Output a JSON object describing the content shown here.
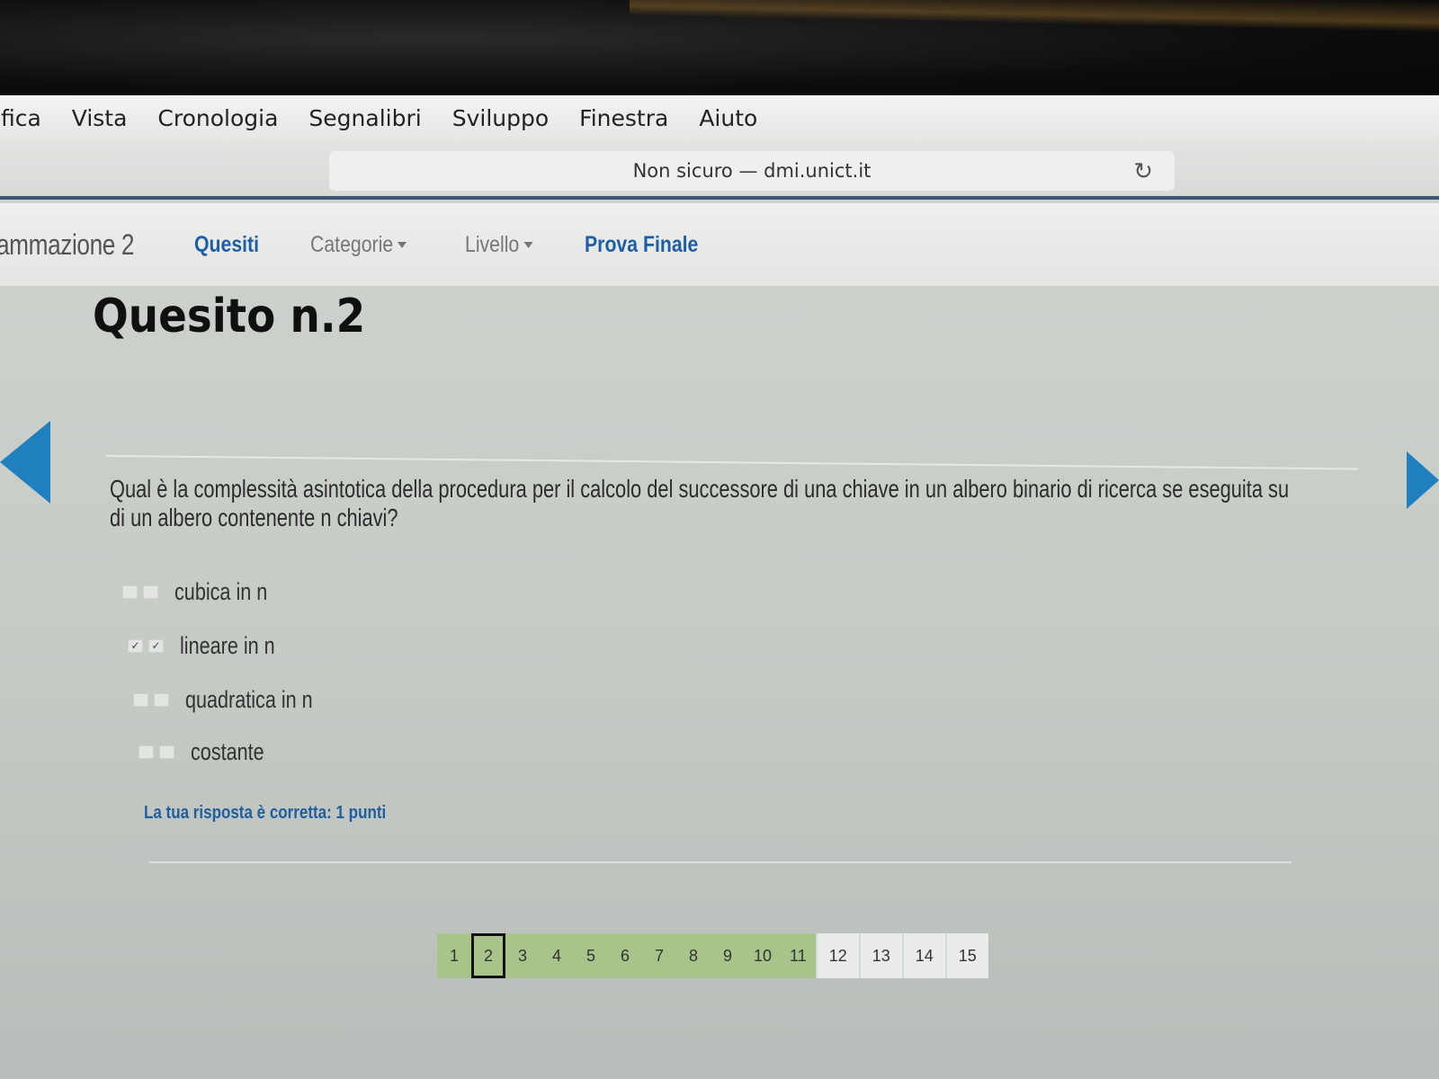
{
  "menubar": {
    "items": [
      "ifica",
      "Vista",
      "Cronologia",
      "Segnalibri",
      "Sviluppo",
      "Finestra",
      "Aiuto"
    ]
  },
  "menu_icons": [
    "dropbox-icon",
    "shield-icon",
    "script-icon",
    "bluetooth-icon"
  ],
  "address_bar": {
    "text": "Non sicuro — dmi.unict.it",
    "reload_icon": "reload-icon"
  },
  "navbar": {
    "brand": "ammazione 2",
    "items": [
      {
        "label": "Quesiti",
        "active": true,
        "dropdown": false
      },
      {
        "label": "Categorie",
        "active": false,
        "dropdown": true
      },
      {
        "label": "Livello",
        "active": false,
        "dropdown": true
      },
      {
        "label": "Prova Finale",
        "active": true,
        "dropdown": false
      }
    ]
  },
  "question": {
    "title": "Quesito n.2",
    "text": "Qual è la complessità asintotica della procedura per il calcolo del successore di una chiave in un albero binario di ricerca se eseguita su di un albero contenente n chiavi?",
    "options": [
      {
        "label": "cubica in n",
        "checked": false
      },
      {
        "label": "lineare in n",
        "checked": true
      },
      {
        "label": "quadratica in n",
        "checked": false
      },
      {
        "label": "costante",
        "checked": false
      }
    ],
    "feedback": "La tua risposta è corretta: 1 punti"
  },
  "pagination": {
    "pages": [
      "1",
      "2",
      "3",
      "4",
      "5",
      "6",
      "7",
      "8",
      "9",
      "10",
      "11",
      "12",
      "13",
      "14",
      "15"
    ],
    "current": "2",
    "answered_count": 11
  },
  "colors": {
    "accent_blue": "#1f7fbf",
    "link_blue": "#1d5fa6",
    "answered_green": "#a8c48a"
  }
}
